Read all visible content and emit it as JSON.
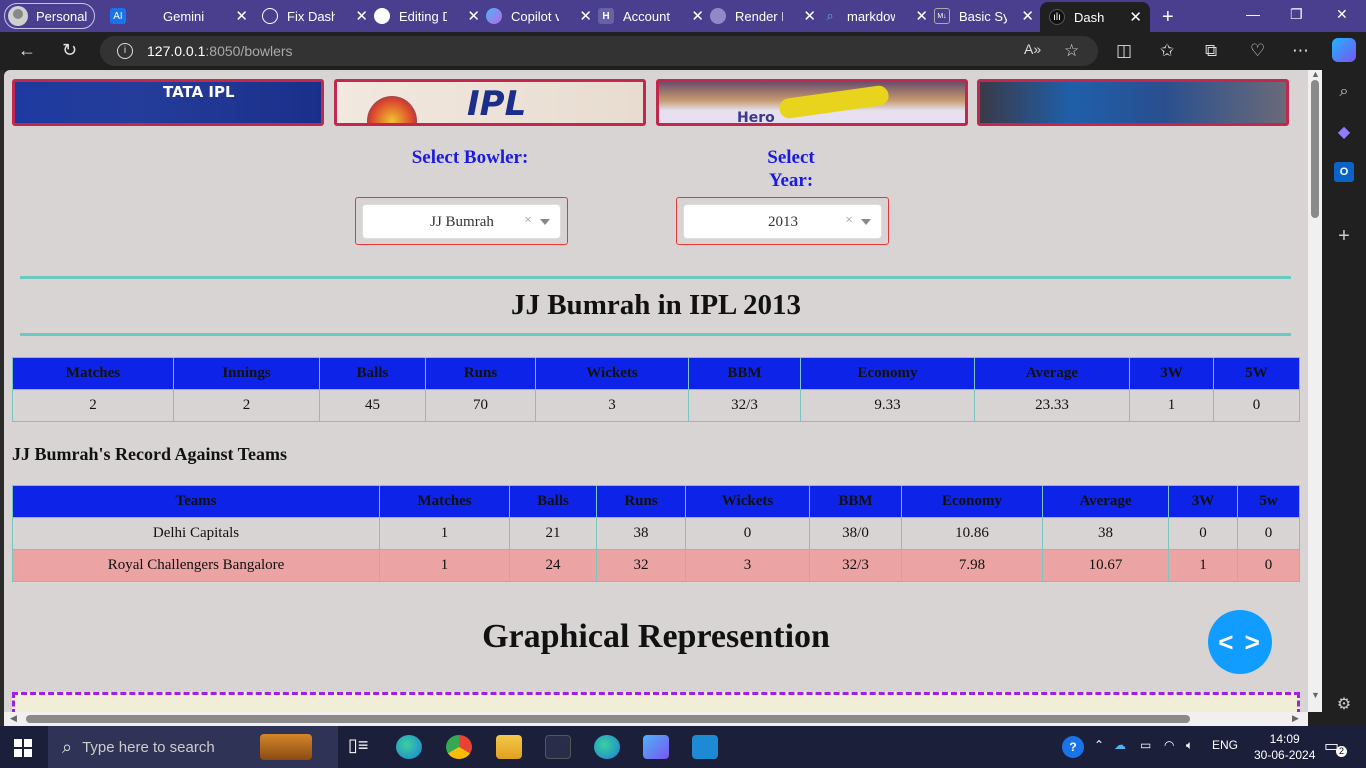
{
  "browser": {
    "profile_label": "Personal",
    "tabs": [
      {
        "title": "Gemini",
        "favicon": "AI",
        "favicon_color": "#1a73e8"
      },
      {
        "title": "Fix Dash",
        "favicon": "chatgpt-icon",
        "favicon_color": "#202020"
      },
      {
        "title": "Editing D",
        "favicon": "github-icon",
        "favicon_color": "#202020"
      },
      {
        "title": "Copilot v",
        "favicon": "copilot-icon",
        "favicon_color": "#7b5bd6"
      },
      {
        "title": "Account",
        "favicon": "heroku-icon",
        "favicon_color": "#6762a6"
      },
      {
        "title": "Render D",
        "favicon": "render-icon",
        "favicon_color": "#5a5a9a"
      },
      {
        "title": "markdow",
        "favicon": "search-icon",
        "favicon_color": "#4a3f8f"
      },
      {
        "title": "Basic Syn",
        "favicon": "md-icon",
        "favicon_color": "#555"
      },
      {
        "title": "Dash",
        "favicon": "dash-icon",
        "favicon_color": "#111"
      }
    ],
    "address": {
      "host": "127.0.0.1",
      "path": ":8050/bowlers"
    }
  },
  "page": {
    "bowler_label": "Select Bowler:",
    "year_label": "Select Year:",
    "bowler_value": "JJ Bumrah",
    "year_value": "2013",
    "title": "JJ Bumrah in IPL 2013",
    "summary_table": {
      "headers": [
        "Matches",
        "Innings",
        "Balls",
        "Runs",
        "Wickets",
        "BBM",
        "Economy",
        "Average",
        "3W",
        "5W"
      ],
      "row": [
        "2",
        "2",
        "45",
        "70",
        "3",
        "32/3",
        "9.33",
        "23.33",
        "1",
        "0"
      ]
    },
    "teams_heading": "JJ Bumrah's Record Against Teams",
    "teams_table": {
      "headers": [
        "Teams",
        "Matches",
        "Balls",
        "Runs",
        "Wickets",
        "BBM",
        "Economy",
        "Average",
        "3W",
        "5w"
      ],
      "rows": [
        [
          "Delhi Capitals",
          "1",
          "21",
          "38",
          "0",
          "38/0",
          "10.86",
          "38",
          "0",
          "0"
        ],
        [
          "Royal Challengers Bangalore",
          "1",
          "24",
          "32",
          "3",
          "32/3",
          "7.98",
          "10.67",
          "1",
          "0"
        ]
      ]
    },
    "graph_heading": "Graphical Represention",
    "fab_label": "< >",
    "banners": [
      {
        "caption": "TATA IPL"
      },
      {
        "caption": "IPL"
      },
      {
        "caption": "Hero"
      },
      {
        "caption": ""
      }
    ]
  },
  "taskbar": {
    "search_placeholder": "Type here to search",
    "language": "ENG",
    "time": "14:09",
    "date": "30-06-2024",
    "notifications": "2"
  },
  "colors": {
    "header_blue": "#0d24e8",
    "label_blue": "#1a1ae0",
    "pink_row": "#eca3a3",
    "page_bg": "#d8d4d4",
    "fab": "#119dff"
  }
}
